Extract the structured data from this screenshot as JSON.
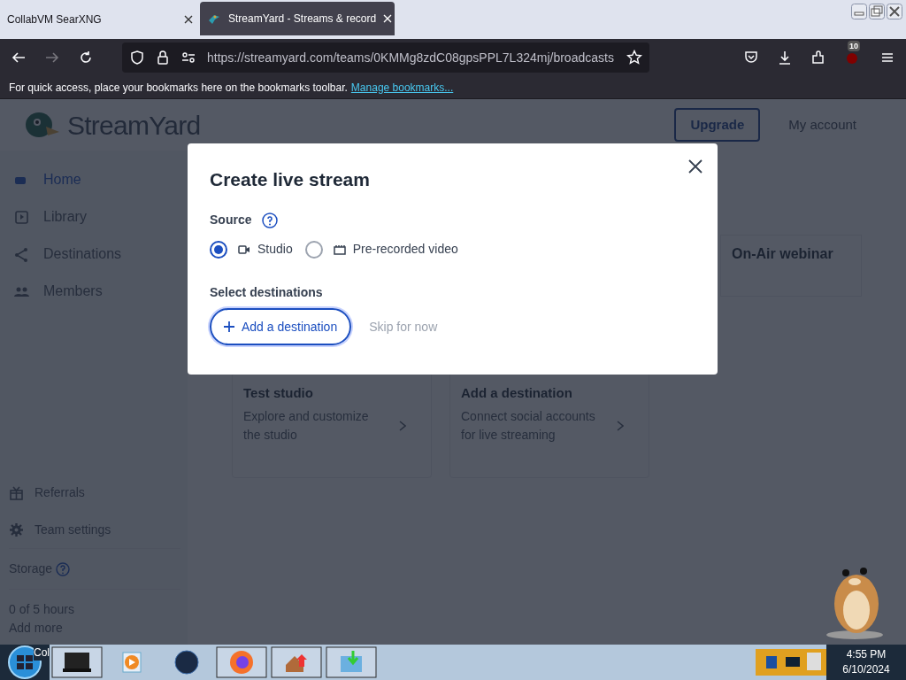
{
  "browser": {
    "tabs": [
      {
        "title": "CollabVM SearXNG",
        "selected": false
      },
      {
        "title": "StreamYard - Streams & record",
        "selected": true
      }
    ],
    "url": "https://streamyard.com/teams/0KMMg8zdC08gpsPPL7L324mj/broadcasts",
    "extension_badge": "10",
    "bookmarks_hint": "For quick access, place your bookmarks here on the bookmarks toolbar.",
    "bookmarks_link": "Manage bookmarks..."
  },
  "page": {
    "logo_text": "StreamYard",
    "header_buttons": [
      {
        "label": "Upgrade",
        "kind": "outlined"
      },
      {
        "label": "My account",
        "kind": "plain"
      }
    ],
    "sidebar": {
      "items": [
        {
          "label": "Home",
          "selected": true
        },
        {
          "label": "Library",
          "selected": false
        },
        {
          "label": "Destinations",
          "selected": false
        },
        {
          "label": "Members",
          "selected": false
        }
      ],
      "bottom_items": [
        {
          "label": "Referrals"
        },
        {
          "label": "Team settings"
        }
      ],
      "storage_label": "Storage",
      "storage_usage": "0 of 5 hours",
      "storage_link": "Add more"
    },
    "side_card": {
      "title": "On-Air webinar"
    },
    "cards": [
      {
        "title": "Test studio",
        "text": "Explore and customize the studio"
      },
      {
        "title": "Add a destination",
        "text": "Connect social accounts for live streaming"
      }
    ]
  },
  "dialog": {
    "title": "Create live stream",
    "source_label": "Source",
    "sources": [
      {
        "label": "Studio",
        "kind": "camera",
        "selected": true
      },
      {
        "label": "Pre-recorded video",
        "kind": "film",
        "selected": false
      }
    ],
    "destinations_label": "Select destinations",
    "add_button": "Add a destination",
    "skip_link": "Skip for now"
  },
  "taskbar": {
    "tooltip": "Col",
    "time": "4:55 PM",
    "date": "6/10/2024"
  }
}
